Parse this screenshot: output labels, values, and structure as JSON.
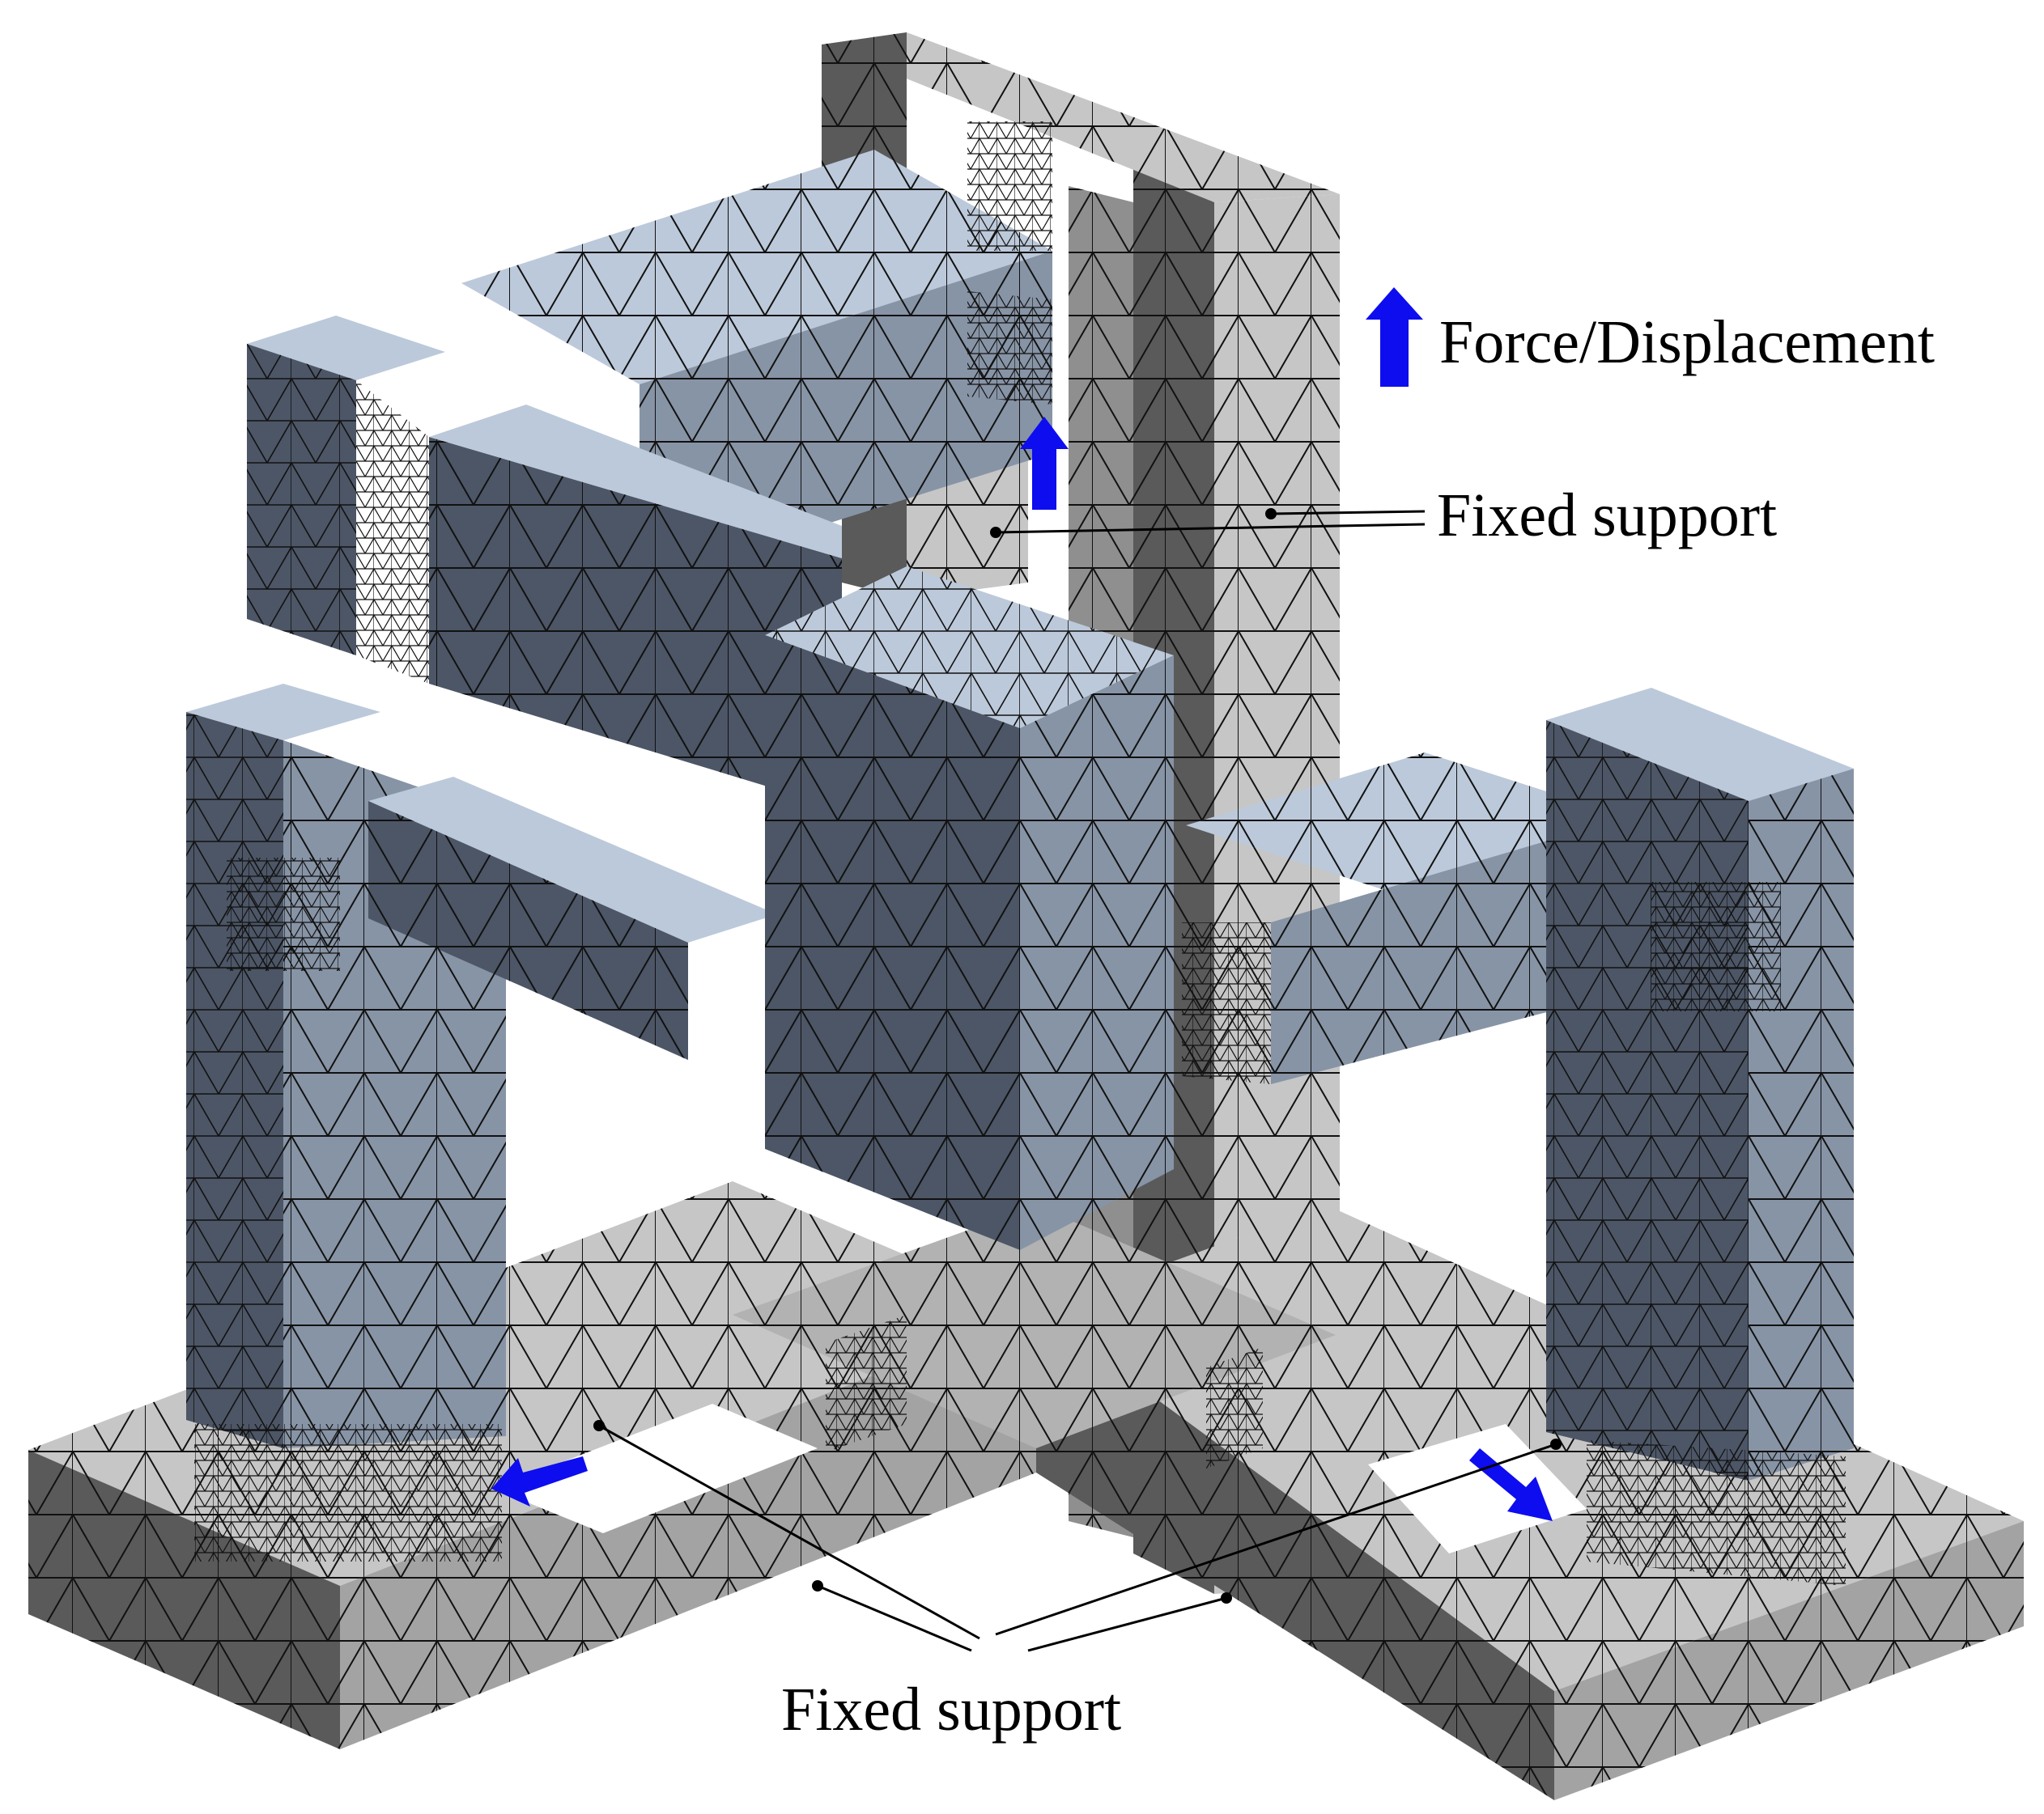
{
  "labels": {
    "legend": "Force/Displacement",
    "fixed_support_top": "Fixed support",
    "fixed_support_bottom": "Fixed support"
  },
  "colors": {
    "background": "#ffffff",
    "moving_body_top": "#bcc9da",
    "moving_body_side": "#4c5666",
    "moving_body_side_light": "#8794a6",
    "fixed_body_top": "#c6c6c6",
    "fixed_body_side": "#5a5a5a",
    "fixed_body_side_mid": "#8f8f8f",
    "mesh_line": "#111111",
    "arrow": "#0d0df0"
  },
  "icons": {
    "load_arrow": "blue-arrow-icon",
    "support_point": "dot-marker"
  }
}
